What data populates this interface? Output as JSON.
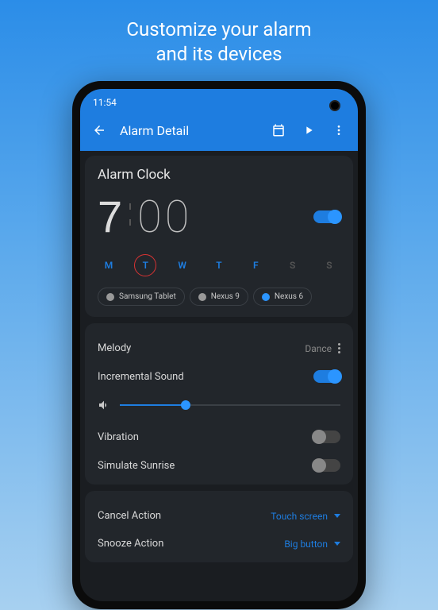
{
  "marketing": {
    "line1": "Customize your alarm",
    "line2": "and its devices"
  },
  "statusBar": {
    "time": "11:54"
  },
  "appBar": {
    "title": "Alarm Detail"
  },
  "alarm": {
    "title": "Alarm Clock",
    "hour": "7",
    "minute": "00",
    "enabled": true,
    "days": [
      {
        "label": "M",
        "active": true,
        "selected": false
      },
      {
        "label": "T",
        "active": true,
        "selected": true
      },
      {
        "label": "W",
        "active": true,
        "selected": false
      },
      {
        "label": "T",
        "active": true,
        "selected": false
      },
      {
        "label": "F",
        "active": true,
        "selected": false
      },
      {
        "label": "S",
        "active": false,
        "selected": false
      },
      {
        "label": "S",
        "active": false,
        "selected": false
      }
    ],
    "devices": [
      {
        "name": "Samsung Tablet",
        "active": false
      },
      {
        "name": "Nexus 9",
        "active": false
      },
      {
        "name": "Nexus 6",
        "active": true
      }
    ]
  },
  "sound": {
    "melodyLabel": "Melody",
    "melodyValue": "Dance",
    "incrementalLabel": "Incremental Sound",
    "incrementalEnabled": true,
    "volumePercent": 30,
    "vibrationLabel": "Vibration",
    "vibrationEnabled": false,
    "sunriseLabel": "Simulate Sunrise",
    "sunriseEnabled": false
  },
  "actions": {
    "cancelLabel": "Cancel Action",
    "cancelValue": "Touch screen",
    "snoozeLabel": "Snooze Action",
    "snoozeValue": "Big button"
  }
}
